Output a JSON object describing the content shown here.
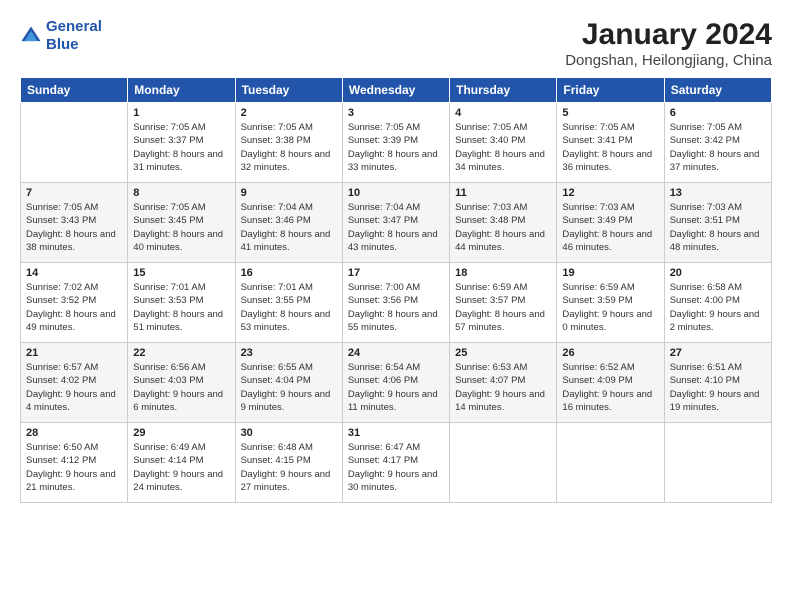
{
  "logo": {
    "line1": "General",
    "line2": "Blue"
  },
  "title": "January 2024",
  "subtitle": "Dongshan, Heilongjiang, China",
  "weekdays": [
    "Sunday",
    "Monday",
    "Tuesday",
    "Wednesday",
    "Thursday",
    "Friday",
    "Saturday"
  ],
  "weeks": [
    [
      {
        "day": "",
        "sunrise": "",
        "sunset": "",
        "daylight": ""
      },
      {
        "day": "1",
        "sunrise": "Sunrise: 7:05 AM",
        "sunset": "Sunset: 3:37 PM",
        "daylight": "Daylight: 8 hours and 31 minutes."
      },
      {
        "day": "2",
        "sunrise": "Sunrise: 7:05 AM",
        "sunset": "Sunset: 3:38 PM",
        "daylight": "Daylight: 8 hours and 32 minutes."
      },
      {
        "day": "3",
        "sunrise": "Sunrise: 7:05 AM",
        "sunset": "Sunset: 3:39 PM",
        "daylight": "Daylight: 8 hours and 33 minutes."
      },
      {
        "day": "4",
        "sunrise": "Sunrise: 7:05 AM",
        "sunset": "Sunset: 3:40 PM",
        "daylight": "Daylight: 8 hours and 34 minutes."
      },
      {
        "day": "5",
        "sunrise": "Sunrise: 7:05 AM",
        "sunset": "Sunset: 3:41 PM",
        "daylight": "Daylight: 8 hours and 36 minutes."
      },
      {
        "day": "6",
        "sunrise": "Sunrise: 7:05 AM",
        "sunset": "Sunset: 3:42 PM",
        "daylight": "Daylight: 8 hours and 37 minutes."
      }
    ],
    [
      {
        "day": "7",
        "sunrise": "Sunrise: 7:05 AM",
        "sunset": "Sunset: 3:43 PM",
        "daylight": "Daylight: 8 hours and 38 minutes."
      },
      {
        "day": "8",
        "sunrise": "Sunrise: 7:05 AM",
        "sunset": "Sunset: 3:45 PM",
        "daylight": "Daylight: 8 hours and 40 minutes."
      },
      {
        "day": "9",
        "sunrise": "Sunrise: 7:04 AM",
        "sunset": "Sunset: 3:46 PM",
        "daylight": "Daylight: 8 hours and 41 minutes."
      },
      {
        "day": "10",
        "sunrise": "Sunrise: 7:04 AM",
        "sunset": "Sunset: 3:47 PM",
        "daylight": "Daylight: 8 hours and 43 minutes."
      },
      {
        "day": "11",
        "sunrise": "Sunrise: 7:03 AM",
        "sunset": "Sunset: 3:48 PM",
        "daylight": "Daylight: 8 hours and 44 minutes."
      },
      {
        "day": "12",
        "sunrise": "Sunrise: 7:03 AM",
        "sunset": "Sunset: 3:49 PM",
        "daylight": "Daylight: 8 hours and 46 minutes."
      },
      {
        "day": "13",
        "sunrise": "Sunrise: 7:03 AM",
        "sunset": "Sunset: 3:51 PM",
        "daylight": "Daylight: 8 hours and 48 minutes."
      }
    ],
    [
      {
        "day": "14",
        "sunrise": "Sunrise: 7:02 AM",
        "sunset": "Sunset: 3:52 PM",
        "daylight": "Daylight: 8 hours and 49 minutes."
      },
      {
        "day": "15",
        "sunrise": "Sunrise: 7:01 AM",
        "sunset": "Sunset: 3:53 PM",
        "daylight": "Daylight: 8 hours and 51 minutes."
      },
      {
        "day": "16",
        "sunrise": "Sunrise: 7:01 AM",
        "sunset": "Sunset: 3:55 PM",
        "daylight": "Daylight: 8 hours and 53 minutes."
      },
      {
        "day": "17",
        "sunrise": "Sunrise: 7:00 AM",
        "sunset": "Sunset: 3:56 PM",
        "daylight": "Daylight: 8 hours and 55 minutes."
      },
      {
        "day": "18",
        "sunrise": "Sunrise: 6:59 AM",
        "sunset": "Sunset: 3:57 PM",
        "daylight": "Daylight: 8 hours and 57 minutes."
      },
      {
        "day": "19",
        "sunrise": "Sunrise: 6:59 AM",
        "sunset": "Sunset: 3:59 PM",
        "daylight": "Daylight: 9 hours and 0 minutes."
      },
      {
        "day": "20",
        "sunrise": "Sunrise: 6:58 AM",
        "sunset": "Sunset: 4:00 PM",
        "daylight": "Daylight: 9 hours and 2 minutes."
      }
    ],
    [
      {
        "day": "21",
        "sunrise": "Sunrise: 6:57 AM",
        "sunset": "Sunset: 4:02 PM",
        "daylight": "Daylight: 9 hours and 4 minutes."
      },
      {
        "day": "22",
        "sunrise": "Sunrise: 6:56 AM",
        "sunset": "Sunset: 4:03 PM",
        "daylight": "Daylight: 9 hours and 6 minutes."
      },
      {
        "day": "23",
        "sunrise": "Sunrise: 6:55 AM",
        "sunset": "Sunset: 4:04 PM",
        "daylight": "Daylight: 9 hours and 9 minutes."
      },
      {
        "day": "24",
        "sunrise": "Sunrise: 6:54 AM",
        "sunset": "Sunset: 4:06 PM",
        "daylight": "Daylight: 9 hours and 11 minutes."
      },
      {
        "day": "25",
        "sunrise": "Sunrise: 6:53 AM",
        "sunset": "Sunset: 4:07 PM",
        "daylight": "Daylight: 9 hours and 14 minutes."
      },
      {
        "day": "26",
        "sunrise": "Sunrise: 6:52 AM",
        "sunset": "Sunset: 4:09 PM",
        "daylight": "Daylight: 9 hours and 16 minutes."
      },
      {
        "day": "27",
        "sunrise": "Sunrise: 6:51 AM",
        "sunset": "Sunset: 4:10 PM",
        "daylight": "Daylight: 9 hours and 19 minutes."
      }
    ],
    [
      {
        "day": "28",
        "sunrise": "Sunrise: 6:50 AM",
        "sunset": "Sunset: 4:12 PM",
        "daylight": "Daylight: 9 hours and 21 minutes."
      },
      {
        "day": "29",
        "sunrise": "Sunrise: 6:49 AM",
        "sunset": "Sunset: 4:14 PM",
        "daylight": "Daylight: 9 hours and 24 minutes."
      },
      {
        "day": "30",
        "sunrise": "Sunrise: 6:48 AM",
        "sunset": "Sunset: 4:15 PM",
        "daylight": "Daylight: 9 hours and 27 minutes."
      },
      {
        "day": "31",
        "sunrise": "Sunrise: 6:47 AM",
        "sunset": "Sunset: 4:17 PM",
        "daylight": "Daylight: 9 hours and 30 minutes."
      },
      {
        "day": "",
        "sunrise": "",
        "sunset": "",
        "daylight": ""
      },
      {
        "day": "",
        "sunrise": "",
        "sunset": "",
        "daylight": ""
      },
      {
        "day": "",
        "sunrise": "",
        "sunset": "",
        "daylight": ""
      }
    ]
  ]
}
